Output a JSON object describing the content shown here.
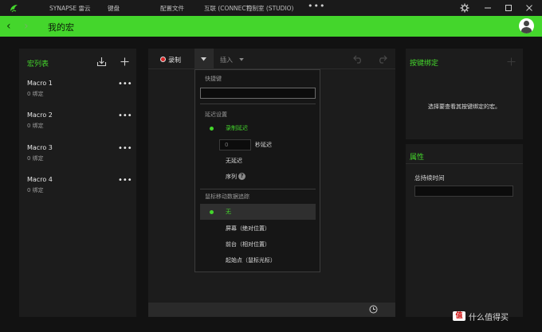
{
  "titlebar": {
    "nav": [
      "SYNAPSE 雷云",
      "键盘",
      "配置文件",
      "互联 (CONNECT)",
      "控制室 (STUDIO)"
    ],
    "more": "•••"
  },
  "header": {
    "title": "我的宏"
  },
  "macro_list": {
    "title": "宏列表",
    "items": [
      {
        "name": "Macro 1",
        "sub": "0 绑定"
      },
      {
        "name": "Macro 2",
        "sub": "0 绑定"
      },
      {
        "name": "Macro 3",
        "sub": "0 绑定"
      },
      {
        "name": "Macro 4",
        "sub": "0 绑定"
      }
    ],
    "more": "•••"
  },
  "editor": {
    "record_label": "录制",
    "insert_label": "插入"
  },
  "dropdown": {
    "hotkey_section": "快捷键",
    "delay_section": "延迟设置",
    "delay_options": [
      "录制延迟",
      "秒延迟",
      "无延迟",
      "序列"
    ],
    "delay_value_placeholder": "0",
    "mouse_section": "鼠标移动数据追踪",
    "mouse_options": [
      "无",
      "屏幕（绝对位置）",
      "前台（相对位置）",
      "起始点（鼠标光标）"
    ]
  },
  "binding": {
    "title": "按键绑定",
    "message": "选择要查看其按键绑定的宏。"
  },
  "properties": {
    "title": "属性",
    "duration_label": "总持续时间"
  },
  "watermark": {
    "badge": "值",
    "text": "什么值得买"
  },
  "colors": {
    "accent": "#44d62c",
    "background": "#121212",
    "panel": "#1c1c1c"
  }
}
